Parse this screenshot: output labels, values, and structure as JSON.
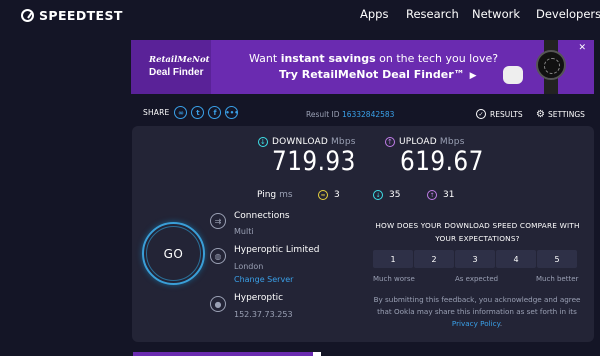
{
  "header": {
    "logo_text": "SPEEDTEST",
    "nav": [
      "Apps",
      "Research",
      "Network",
      "Developers"
    ]
  },
  "ad": {
    "brand_top": "RetailMeNot",
    "brand_bottom": "Deal Finder",
    "line1_pre": "Want ",
    "line1_bold": "instant savings",
    "line1_post": " on the tech you love?",
    "line2": "Try RetailMeNot Deal Finder™",
    "close": "✕"
  },
  "share": {
    "label": "SHARE",
    "icons": [
      "link-icon",
      "twitter-icon",
      "facebook-icon",
      "more-icon"
    ]
  },
  "result": {
    "label": "Result ID",
    "id": "16332842583",
    "results_label": "RESULTS",
    "settings_label": "SETTINGS"
  },
  "download": {
    "label": "DOWNLOAD",
    "unit": "Mbps",
    "value": "719.93",
    "color": "#3ee0e8"
  },
  "upload": {
    "label": "UPLOAD",
    "unit": "Mbps",
    "value": "619.67",
    "color": "#c07de8"
  },
  "ping": {
    "label": "Ping",
    "unit": "ms",
    "idle": "3",
    "download": "35",
    "upload": "31"
  },
  "go_label": "GO",
  "connections": {
    "title": "Connections",
    "value": "Multi"
  },
  "server": {
    "title": "Hyperoptic Limited",
    "location": "London",
    "change": "Change Server"
  },
  "isp": {
    "title": "Hyperoptic",
    "ip": "152.37.73.253"
  },
  "survey": {
    "question": "HOW DOES YOUR DOWNLOAD SPEED COMPARE WITH YOUR EXPECTATIONS?",
    "ratings": [
      "1",
      "2",
      "3",
      "4",
      "5"
    ],
    "low": "Much worse",
    "mid": "As expected",
    "high": "Much better",
    "disclaimer_pre": "By submitting this feedback, you acknowledge and agree that Ookla may share this information as set forth in its ",
    "privacy": "Privacy Policy",
    "disclaimer_post": "."
  }
}
